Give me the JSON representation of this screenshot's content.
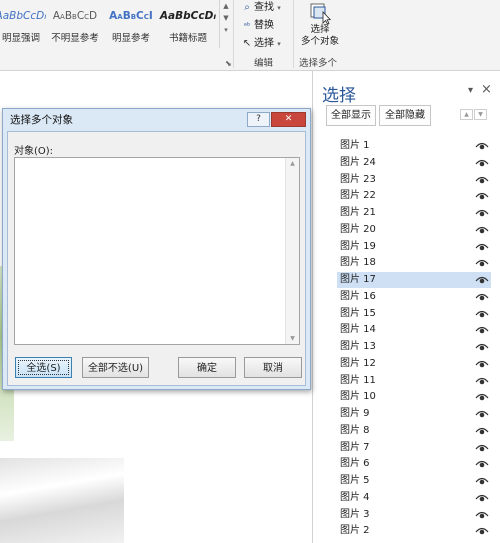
{
  "ribbon": {
    "styles": [
      {
        "preview": "AaBbCcDт",
        "name": "明显强调",
        "color": "#4472c4",
        "italic": true
      },
      {
        "preview": "AaBbCcD",
        "name": "不明显参考",
        "color": "#595959",
        "italic": false
      },
      {
        "preview": "AaBbCcI",
        "name": "明显参考",
        "color": "#4472c4",
        "italic": false
      },
      {
        "preview": "AaBbCcDт",
        "name": "书籍标题",
        "color": "#222222",
        "italic": true
      }
    ],
    "editing": {
      "find": "查找",
      "replace": "替换",
      "select": "选择",
      "group_label": "编辑"
    },
    "select_multiple": {
      "label_line1": "选择",
      "label_line2": "多个对象",
      "group_label": "选择多个"
    }
  },
  "pane": {
    "title": "选择",
    "show_all": "全部显示",
    "hide_all": "全部隐藏",
    "items": [
      "图片 1",
      "图片 24",
      "图片 23",
      "图片 22",
      "图片 21",
      "图片 20",
      "图片 19",
      "图片 18",
      "图片 17",
      "图片 16",
      "图片 15",
      "图片 14",
      "图片 13",
      "图片 12",
      "图片 11",
      "图片 10",
      "图片 9",
      "图片 8",
      "图片 7",
      "图片 6",
      "图片 5",
      "图片 4",
      "图片 3",
      "图片 2"
    ],
    "selected_item": "图片 17"
  },
  "dialog": {
    "title": "选择多个对象",
    "help": "?",
    "objects_label": "对象(O):",
    "select_all": "全选(S)",
    "deselect_all": "全部不选(U)",
    "ok": "确定",
    "cancel": "取消"
  },
  "colors": {
    "accent": "#2b579a",
    "selection": "#cfe0f5",
    "close_button": "#c9463c"
  }
}
